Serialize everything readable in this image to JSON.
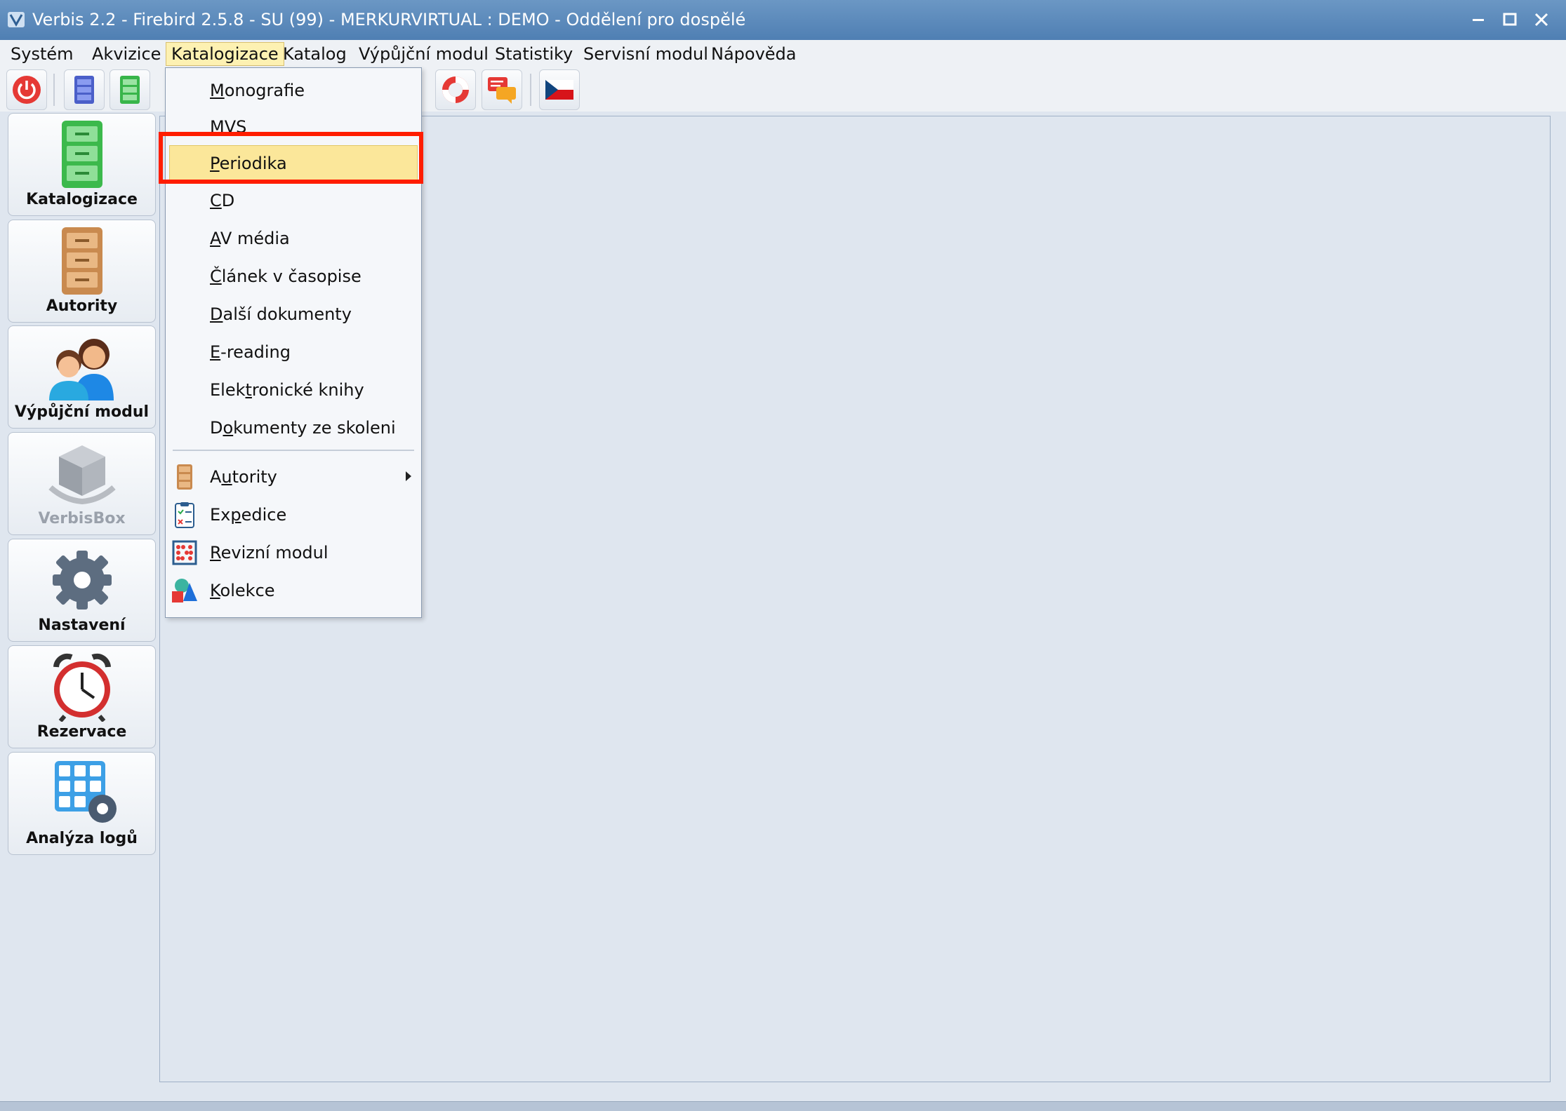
{
  "window": {
    "title": "Verbis 2.2 - Firebird 2.5.8 - SU (99) - MERKURVIRTUAL : DEMO - Oddělení pro dospělé"
  },
  "menubar": {
    "items": [
      "Systém",
      "Akvizice",
      "Katalogizace",
      "Katalog",
      "Výpůjční modul",
      "Statistiky",
      "Servisní modul",
      "Nápověda"
    ],
    "active": "Katalogizace"
  },
  "sidebar": {
    "items": [
      {
        "label": "Katalogizace",
        "icon": "green-cabinet-icon"
      },
      {
        "label": "Autority",
        "icon": "brown-cabinet-icon"
      },
      {
        "label": "Výpůjční modul",
        "icon": "people-icon"
      },
      {
        "label": "VerbisBox",
        "icon": "box-icon"
      },
      {
        "label": "Nastavení",
        "icon": "gear-icon"
      },
      {
        "label": "Rezervace",
        "icon": "alarm-clock-icon"
      },
      {
        "label": "Analýza logů",
        "icon": "grid-gear-icon"
      }
    ]
  },
  "dropdown": {
    "items": [
      {
        "u": "M",
        "rest": "onografie"
      },
      {
        "u": "M",
        "rest": "VS"
      },
      {
        "u": "P",
        "rest": "eriodika"
      },
      {
        "u": "C",
        "rest": "D"
      },
      {
        "u": "A",
        "rest": "V média"
      },
      {
        "u": "Č",
        "rest": "lánek v časopise"
      },
      {
        "u": "D",
        "rest": "alší dokumenty"
      },
      {
        "u": "E",
        "rest": "-reading"
      },
      {
        "pre": "Elek",
        "u": "t",
        "rest": "ronické knihy"
      },
      {
        "pre": "D",
        "u": "o",
        "rest": "kumenty ze skoleni"
      },
      {
        "pre": "A",
        "u": "u",
        "rest": "tority"
      },
      {
        "pre": "Ex",
        "u": "p",
        "rest": "edice"
      },
      {
        "u": "R",
        "rest": "evizní modul"
      },
      {
        "u": "K",
        "rest": "olekce"
      }
    ],
    "highlighted": "Periodika"
  },
  "colors": {
    "highlight": "#fbe79a",
    "annotation": "#ff1d00",
    "titlebar": "#5a87b9"
  }
}
